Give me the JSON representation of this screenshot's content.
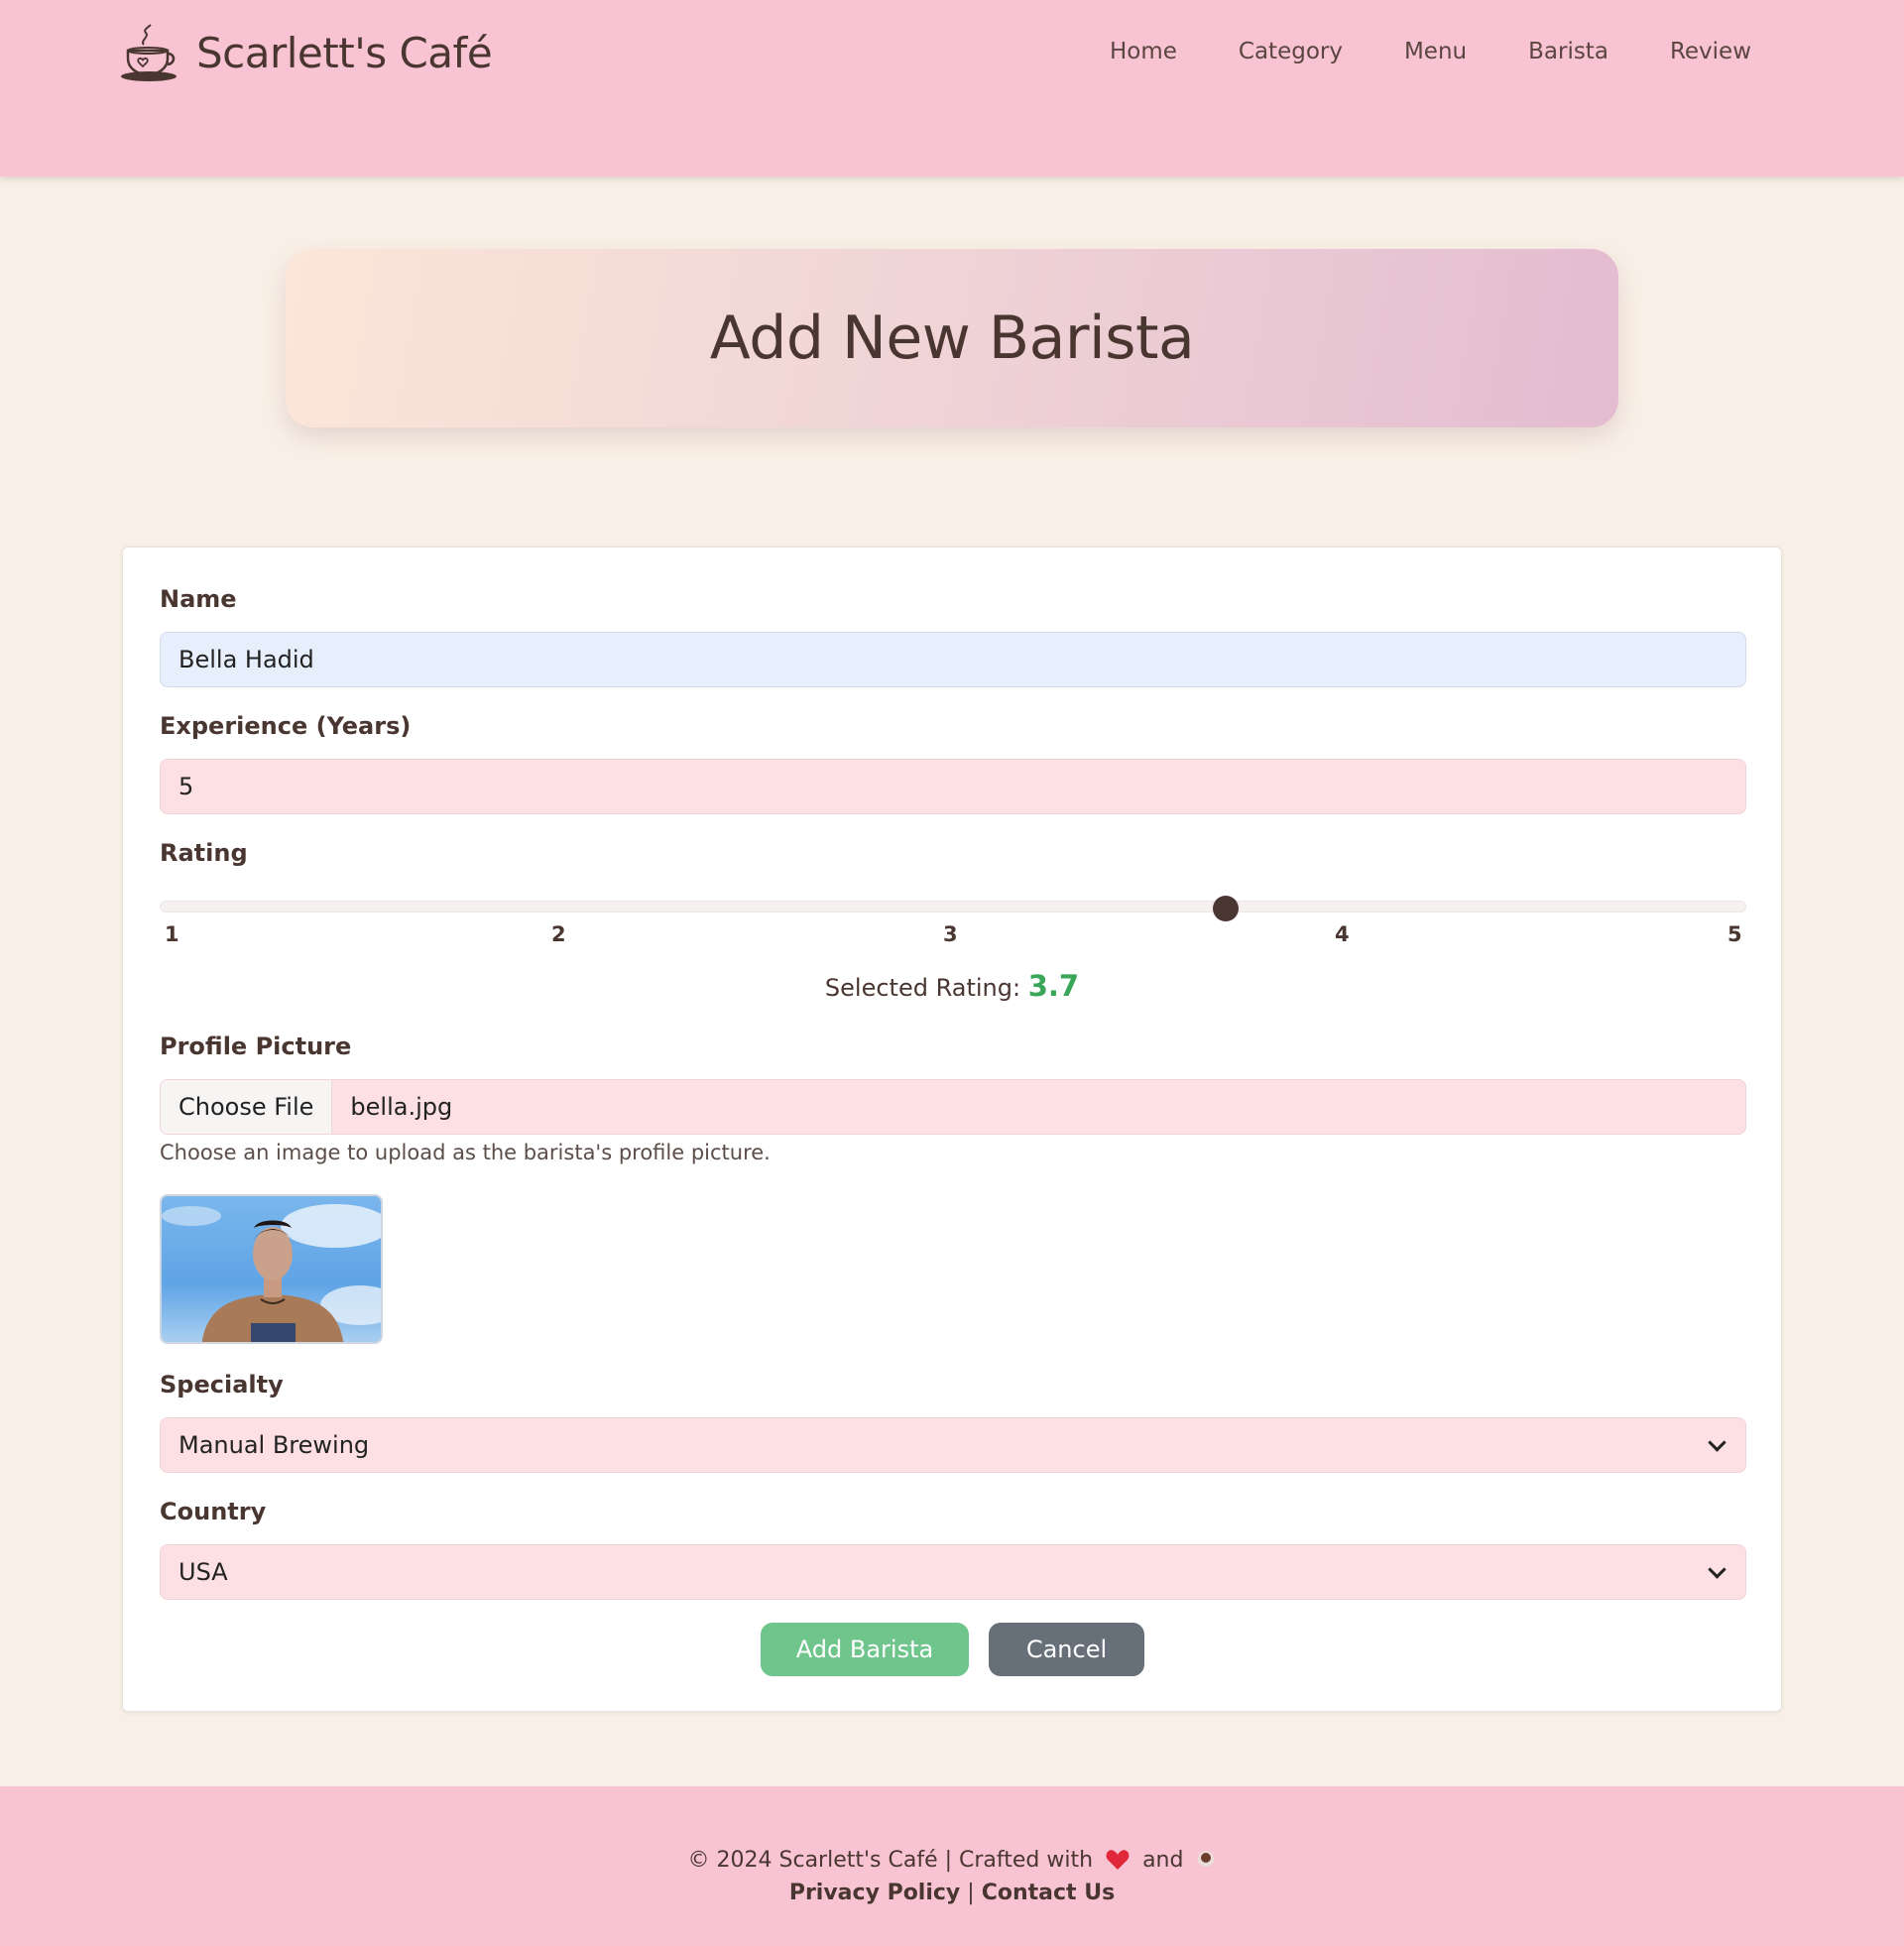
{
  "header": {
    "brand": "Scarlett's Café",
    "logo_icon": "coffee-cup-icon",
    "nav": [
      "Home",
      "Category",
      "Menu",
      "Barista",
      "Review"
    ]
  },
  "banner": {
    "title": "Add New Barista"
  },
  "form": {
    "name": {
      "label": "Name",
      "value": "Bella Hadid"
    },
    "experience": {
      "label": "Experience (Years)",
      "value": "5"
    },
    "rating": {
      "label": "Rating",
      "min": 1,
      "max": 5,
      "value": 3.7,
      "ticks": [
        "1",
        "2",
        "3",
        "4",
        "5"
      ],
      "selected_label": "Selected Rating:",
      "selected_value": "3.7"
    },
    "profile_picture": {
      "label": "Profile Picture",
      "button_label": "Choose File",
      "file_name": "bella.jpg",
      "hint": "Choose an image to upload as the barista's profile picture."
    },
    "specialty": {
      "label": "Specialty",
      "value": "Manual Brewing"
    },
    "country": {
      "label": "Country",
      "value": "USA"
    },
    "submit_label": "Add Barista",
    "cancel_label": "Cancel"
  },
  "colors": {
    "header_bg": "#f8c3d2",
    "page_bg": "#f8efe6",
    "text": "#4a3630",
    "add_button": "#70c58c",
    "cancel_button": "#676f78",
    "rating_value": "#3aa65a"
  },
  "footer": {
    "copyright_prefix": "© 2024 Scarlett's Café | Crafted with",
    "and": "and",
    "heart_icon": "heart-icon",
    "coffee_icon": "coffee-icon",
    "privacy": "Privacy Policy",
    "separator": "|",
    "contact": "Contact Us"
  }
}
